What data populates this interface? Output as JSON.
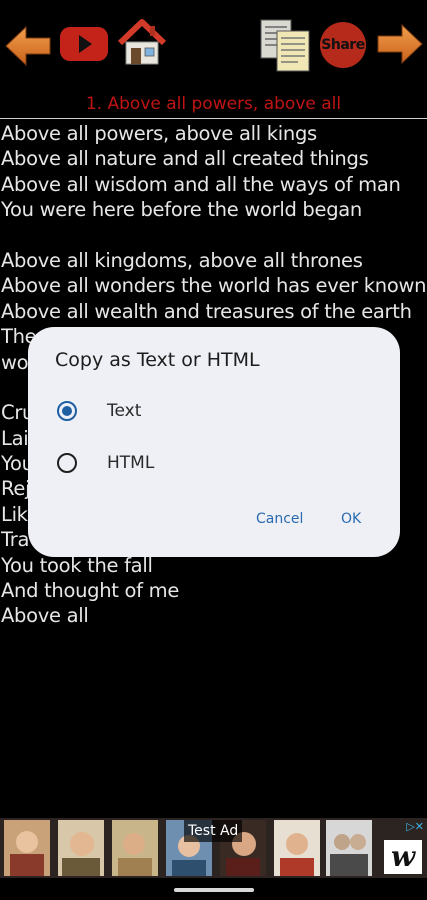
{
  "toolbar": {
    "back_icon": "left-arrow-icon",
    "video_icon": "youtube-play-icon",
    "home_icon": "home-icon",
    "copy_icon": "copy-documents-icon",
    "share_label": "Share",
    "next_icon": "right-arrow-icon",
    "accent_orange": "#e8792a",
    "accent_red": "#c4231a"
  },
  "song": {
    "title": "1. Above all powers, above all",
    "title_color": "#c01414",
    "lines": [
      "Above all powers, above all kings",
      "Above all nature and all created things",
      "Above all wisdom and all the ways of man",
      "You were here before the world began",
      "",
      "Above all kingdoms, above all thrones",
      "Above all wonders the world has ever known",
      "Above all wealth and treasures of the earth",
      "The",
      "wo",
      "",
      "Cru",
      "Lai",
      "You",
      "Rej",
      "Lik",
      "Tra",
      "You took the fall",
      "And thought of me",
      "Above all"
    ]
  },
  "dialog": {
    "title": "Copy as Text or HTML",
    "options": [
      {
        "label": "Text",
        "selected": true
      },
      {
        "label": "HTML",
        "selected": false
      }
    ],
    "cancel_label": "Cancel",
    "ok_label": "OK",
    "accent": "#1e5fa3"
  },
  "ad": {
    "label": "Test Ad",
    "choices_icon": "adchoices-icon",
    "logo_letter": "w"
  }
}
